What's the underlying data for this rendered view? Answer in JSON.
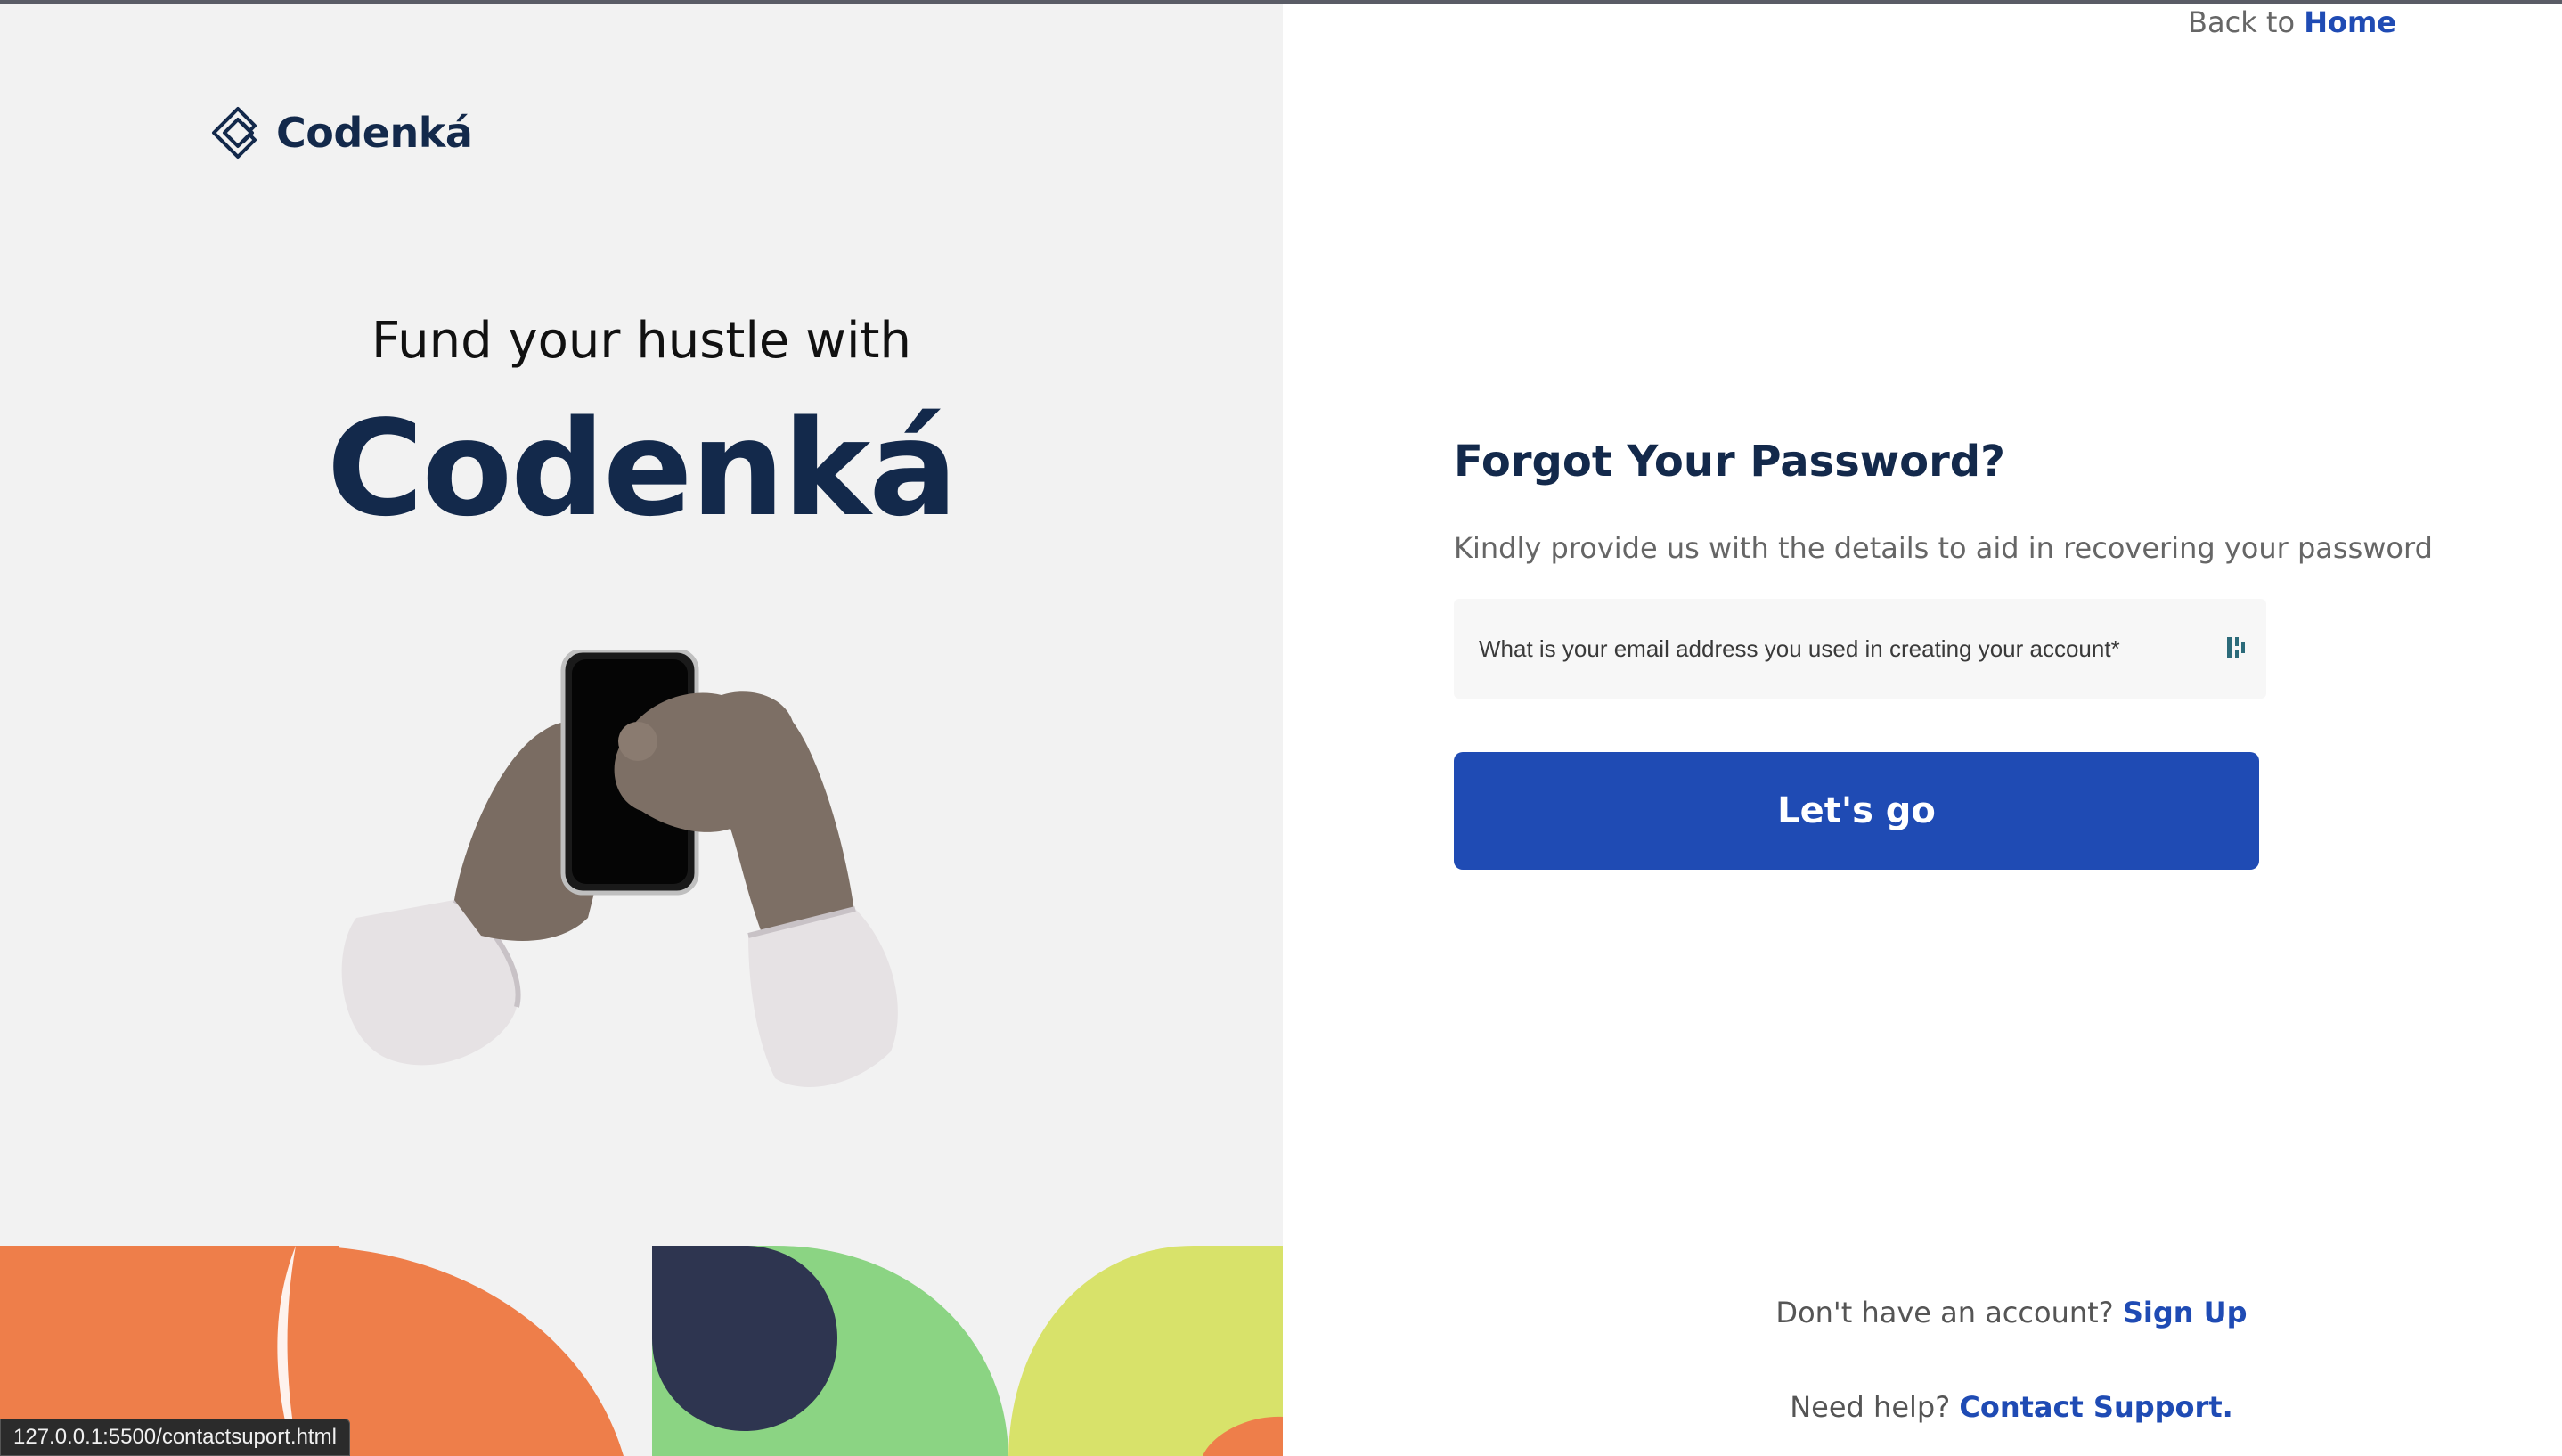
{
  "header": {
    "back_prefix": "Back to",
    "back_link": "Home"
  },
  "left_panel": {
    "logo_text": "Codenká",
    "tagline": "Fund your hustle with",
    "brand_big": "Codenká",
    "illustration": "hands-holding-phone-illustration"
  },
  "form": {
    "title": "Forgot Your Password?",
    "subtitle": "Kindly provide us with the details to aid in recovering your password",
    "email_placeholder": "What is your email address you used in creating your account*",
    "email_value": "",
    "submit_label": "Let's go"
  },
  "footer": {
    "signup_prefix": "Don't have an account?",
    "signup_link": "Sign Up",
    "help_prefix": "Need help?",
    "help_link": "Contact Support."
  },
  "status_bar": {
    "url": "127.0.0.1:5500/contactsuport.html"
  },
  "colors": {
    "brand_navy": "#13294b",
    "accent_blue": "#1f4bb4",
    "left_bg": "#f2f2f2",
    "shape_orange": "#ee7e4a",
    "shape_green": "#8bd483",
    "shape_yellow": "#d8e26a",
    "shape_navy": "#2e3550"
  }
}
